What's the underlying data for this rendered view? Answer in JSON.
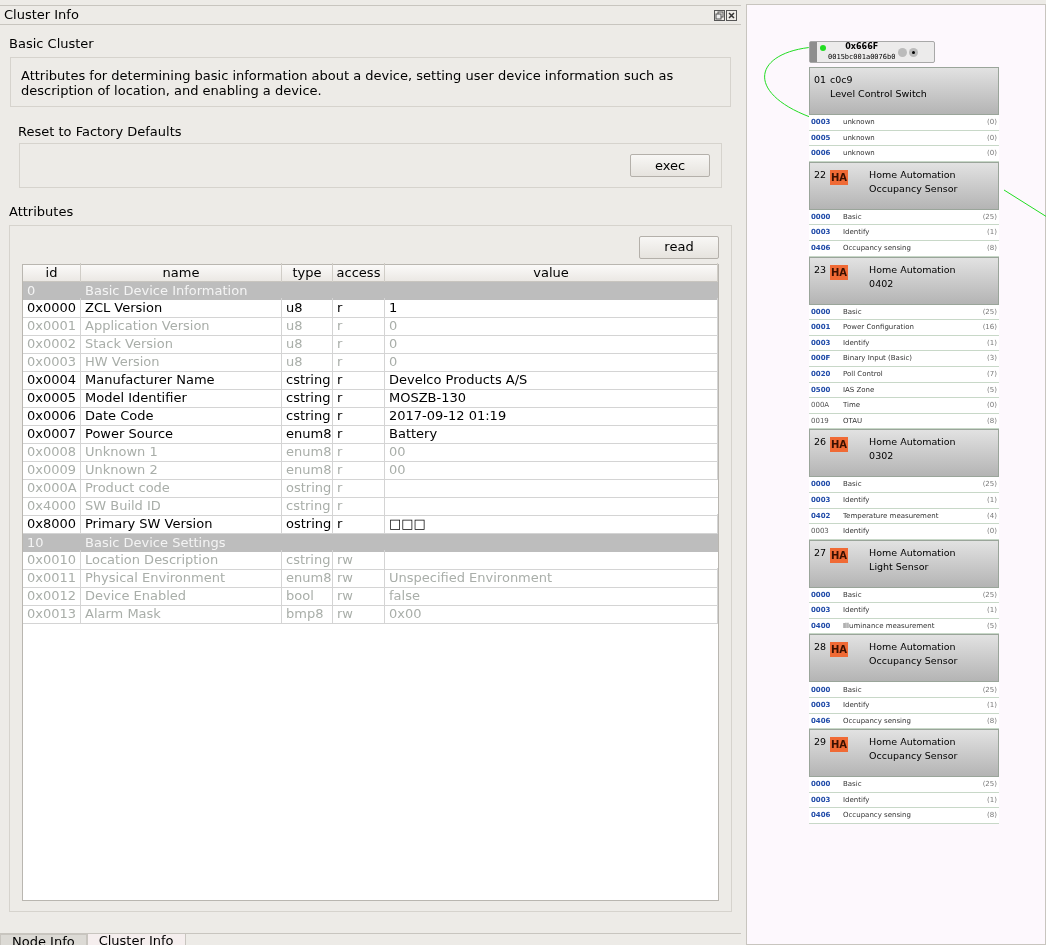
{
  "panel": {
    "title": "Cluster Info"
  },
  "cluster": {
    "name": "Basic Cluster",
    "description": "Attributes for determining basic information about a device, setting user device information such as description of location, and enabling a device."
  },
  "commands": {
    "title": "Reset to Factory Defaults",
    "button": "exec"
  },
  "attributes": {
    "title": "Attributes",
    "button": "read",
    "columns": [
      "id",
      "name",
      "type",
      "access",
      "value"
    ],
    "rows": [
      {
        "kind": "group",
        "id": "0",
        "name": "Basic Device Information"
      },
      {
        "kind": "attr",
        "enabled": true,
        "id": "0x0000",
        "name": "ZCL Version",
        "type": "u8",
        "access": "r",
        "value": "1"
      },
      {
        "kind": "attr",
        "enabled": false,
        "id": "0x0001",
        "name": "Application Version",
        "type": "u8",
        "access": "r",
        "value": "0"
      },
      {
        "kind": "attr",
        "enabled": false,
        "id": "0x0002",
        "name": "Stack Version",
        "type": "u8",
        "access": "r",
        "value": "0"
      },
      {
        "kind": "attr",
        "enabled": false,
        "id": "0x0003",
        "name": "HW Version",
        "type": "u8",
        "access": "r",
        "value": "0"
      },
      {
        "kind": "attr",
        "enabled": true,
        "id": "0x0004",
        "name": "Manufacturer Name",
        "type": "cstring",
        "access": "r",
        "value": "Develco Products A/S"
      },
      {
        "kind": "attr",
        "enabled": true,
        "id": "0x0005",
        "name": "Model Identifier",
        "type": "cstring",
        "access": "r",
        "value": "MOSZB-130"
      },
      {
        "kind": "attr",
        "enabled": true,
        "id": "0x0006",
        "name": "Date Code",
        "type": "cstring",
        "access": "r",
        "value": "2017-09-12 01:19"
      },
      {
        "kind": "attr",
        "enabled": true,
        "id": "0x0007",
        "name": "Power Source",
        "type": "enum8",
        "access": "r",
        "value": "Battery"
      },
      {
        "kind": "attr",
        "enabled": false,
        "id": "0x0008",
        "name": "Unknown 1",
        "type": "enum8",
        "access": "r",
        "value": "00"
      },
      {
        "kind": "attr",
        "enabled": false,
        "id": "0x0009",
        "name": "Unknown 2",
        "type": "enum8",
        "access": "r",
        "value": "00"
      },
      {
        "kind": "attr",
        "enabled": false,
        "id": "0x000A",
        "name": "Product code",
        "type": "ostring",
        "access": "r"
      },
      {
        "kind": "attr",
        "enabled": false,
        "id": "0x4000",
        "name": "SW Build ID",
        "type": "cstring",
        "access": "r"
      },
      {
        "kind": "attr",
        "enabled": true,
        "id": "0x8000",
        "name": "Primary SW Version",
        "type": "ostring",
        "access": "r",
        "value": "□□□"
      },
      {
        "kind": "group",
        "id": "10",
        "name": "Basic Device Settings"
      },
      {
        "kind": "attr",
        "enabled": false,
        "id": "0x0010",
        "name": "Location Description",
        "type": "cstring",
        "access": "rw"
      },
      {
        "kind": "attr",
        "enabled": false,
        "id": "0x0011",
        "name": "Physical Environment",
        "type": "enum8",
        "access": "rw",
        "value": "Unspecified Environment"
      },
      {
        "kind": "attr",
        "enabled": false,
        "id": "0x0012",
        "name": "Device Enabled",
        "type": "bool",
        "access": "rw",
        "value": "false"
      },
      {
        "kind": "attr",
        "enabled": false,
        "id": "0x0013",
        "name": "Alarm Mask",
        "type": "bmp8",
        "access": "rw",
        "value": "0x00"
      }
    ]
  },
  "bottom_tabs": [
    {
      "label": "Node Info",
      "selected": false
    },
    {
      "label": "Cluster Info",
      "selected": true
    }
  ],
  "node": {
    "address": "0x666F",
    "mac": "0015bc001a0076b0",
    "online": true,
    "endpoints": [
      {
        "number": "01",
        "title": "c0c9",
        "subtitle": "Level Control Switch",
        "clusters": [
          {
            "id": "0003",
            "name": "unknown",
            "count": "(0)",
            "kind": "server"
          },
          {
            "id": "0005",
            "name": "unknown",
            "count": "(0)",
            "kind": "server"
          },
          {
            "id": "0006",
            "name": "unknown",
            "count": "(0)",
            "kind": "server"
          }
        ]
      },
      {
        "number": "22",
        "badge": "HA",
        "title": "Home Automation",
        "subtitle": "Occupancy Sensor",
        "clusters": [
          {
            "id": "0000",
            "name": "Basic",
            "count": "(25)",
            "kind": "server"
          },
          {
            "id": "0003",
            "name": "Identify",
            "count": "(1)",
            "kind": "server"
          },
          {
            "id": "0406",
            "name": "Occupancy sensing",
            "count": "(8)",
            "kind": "server"
          }
        ]
      },
      {
        "number": "23",
        "badge": "HA",
        "title": "Home Automation",
        "subtitle": "0402",
        "clusters": [
          {
            "id": "0000",
            "name": "Basic",
            "count": "(25)",
            "kind": "server"
          },
          {
            "id": "0001",
            "name": "Power Configuration",
            "count": "(16)",
            "kind": "server"
          },
          {
            "id": "0003",
            "name": "Identify",
            "count": "(1)",
            "kind": "server"
          },
          {
            "id": "000F",
            "name": "Binary Input (Basic)",
            "count": "(3)",
            "kind": "server"
          },
          {
            "id": "0020",
            "name": "Poll Control",
            "count": "(7)",
            "kind": "server"
          },
          {
            "id": "0500",
            "name": "IAS Zone",
            "count": "(5)",
            "kind": "server"
          },
          {
            "id": "000A",
            "name": "Time",
            "count": "(0)",
            "kind": "client"
          },
          {
            "id": "0019",
            "name": "OTAU",
            "count": "(8)",
            "kind": "client"
          }
        ]
      },
      {
        "number": "26",
        "badge": "HA",
        "title": "Home Automation",
        "subtitle": "0302",
        "clusters": [
          {
            "id": "0000",
            "name": "Basic",
            "count": "(25)",
            "kind": "server"
          },
          {
            "id": "0003",
            "name": "Identify",
            "count": "(1)",
            "kind": "server"
          },
          {
            "id": "0402",
            "name": "Temperature measurement",
            "count": "(4)",
            "kind": "server"
          },
          {
            "id": "0003",
            "name": "Identify",
            "count": "(0)",
            "kind": "client"
          }
        ]
      },
      {
        "number": "27",
        "badge": "HA",
        "title": "Home Automation",
        "subtitle": "Light Sensor",
        "clusters": [
          {
            "id": "0000",
            "name": "Basic",
            "count": "(25)",
            "kind": "server"
          },
          {
            "id": "0003",
            "name": "Identify",
            "count": "(1)",
            "kind": "server"
          },
          {
            "id": "0400",
            "name": "Illuminance measurement",
            "count": "(5)",
            "kind": "server"
          }
        ]
      },
      {
        "number": "28",
        "badge": "HA",
        "title": "Home Automation",
        "subtitle": "Occupancy Sensor",
        "clusters": [
          {
            "id": "0000",
            "name": "Basic",
            "count": "(25)",
            "kind": "server"
          },
          {
            "id": "0003",
            "name": "Identify",
            "count": "(1)",
            "kind": "server"
          },
          {
            "id": "0406",
            "name": "Occupancy sensing",
            "count": "(8)",
            "kind": "server"
          }
        ]
      },
      {
        "number": "29",
        "badge": "HA",
        "title": "Home Automation",
        "subtitle": "Occupancy Sensor",
        "clusters": [
          {
            "id": "0000",
            "name": "Basic",
            "count": "(25)",
            "kind": "server"
          },
          {
            "id": "0003",
            "name": "Identify",
            "count": "(1)",
            "kind": "server"
          },
          {
            "id": "0406",
            "name": "Occupancy sensing",
            "count": "(8)",
            "kind": "server"
          }
        ]
      }
    ]
  }
}
